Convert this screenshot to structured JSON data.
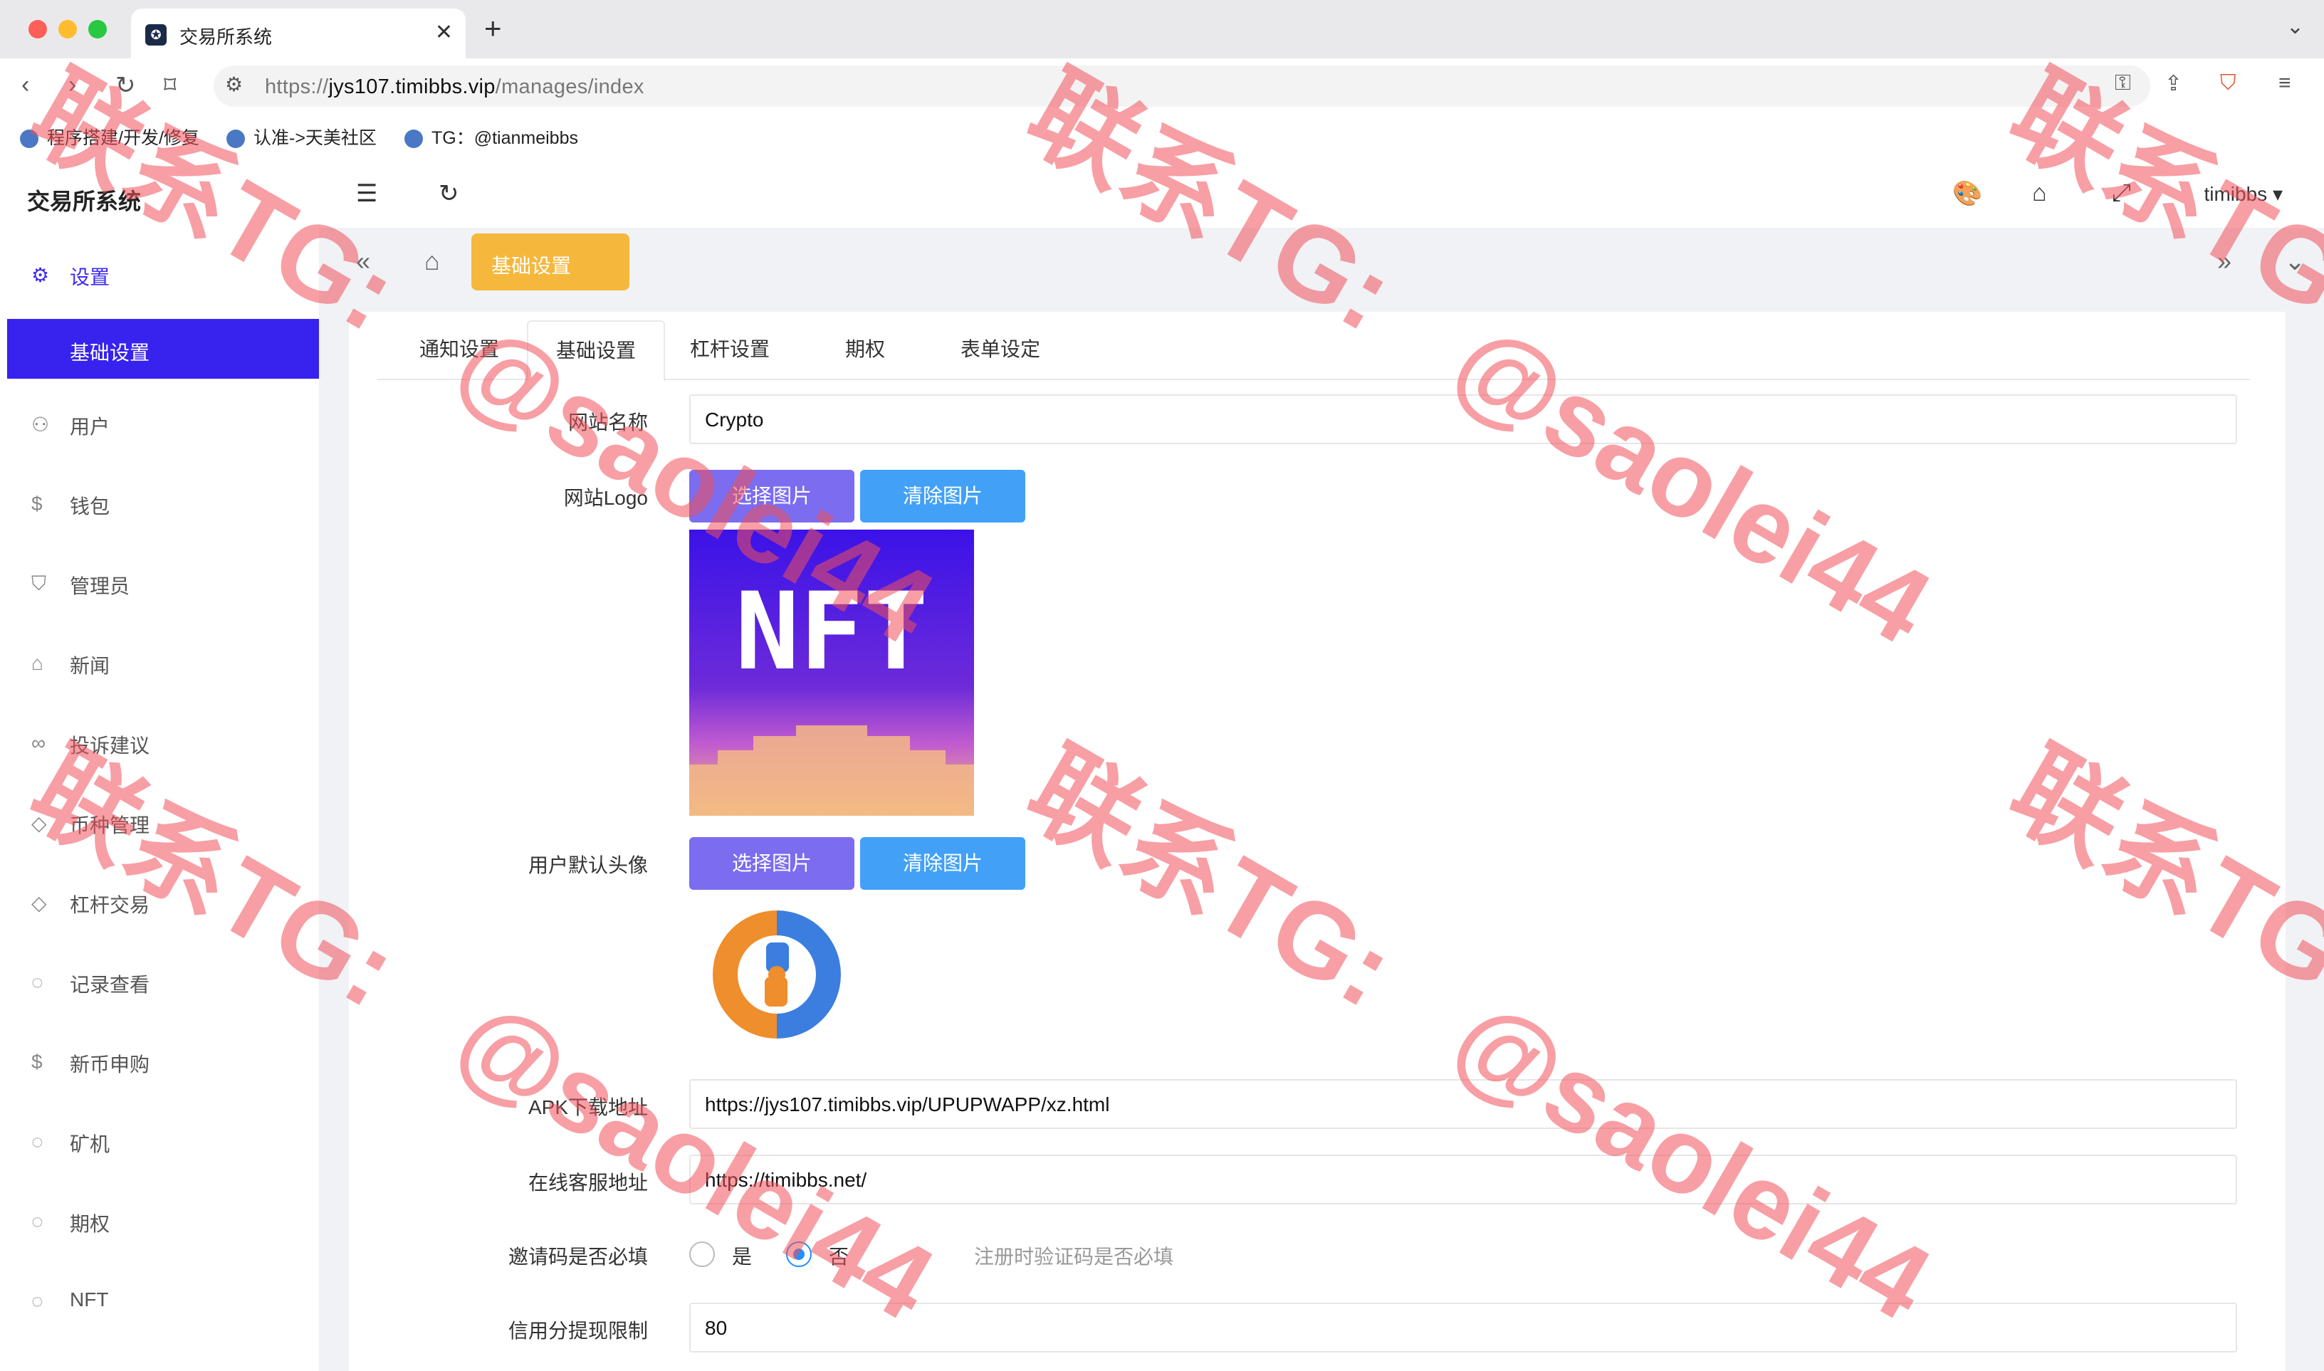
{
  "browser": {
    "tab_title": "交易所系统",
    "url_prefix": "https://",
    "url_host": "jys107.timibbs.vip",
    "url_path": "/manages/index",
    "bookmarks": [
      "程序搭建/开发/修复",
      "认准->天美社区",
      "TG：@tianmeibbs"
    ]
  },
  "sidebar": {
    "title": "交易所系统",
    "items": [
      {
        "label": "设置",
        "icon": "gear-icon"
      },
      {
        "label": "基础设置",
        "icon": ""
      },
      {
        "label": "用户",
        "icon": "user-icon"
      },
      {
        "label": "钱包",
        "icon": "dollar-icon"
      },
      {
        "label": "管理员",
        "icon": "shield-icon"
      },
      {
        "label": "新闻",
        "icon": "tag-icon"
      },
      {
        "label": "投诉建议",
        "icon": "link-icon"
      },
      {
        "label": "币种管理",
        "icon": "diamond-icon"
      },
      {
        "label": "杠杆交易",
        "icon": "diamond-icon"
      },
      {
        "label": "记录查看",
        "icon": "loading-icon"
      },
      {
        "label": "新币申购",
        "icon": "dollar-icon"
      },
      {
        "label": "矿机",
        "icon": "loading-icon"
      },
      {
        "label": "期权",
        "icon": "loading-icon"
      },
      {
        "label": "NFT",
        "icon": "loading-icon"
      }
    ]
  },
  "header": {
    "username": "timibbs"
  },
  "tagbar": {
    "active_tag": "基础设置"
  },
  "tabs": [
    "通知设置",
    "基础设置",
    "杠杆设置",
    "期权",
    "表单设定"
  ],
  "form": {
    "site_name_label": "网站名称",
    "site_name_value": "Crypto",
    "site_logo_label": "网站Logo",
    "select_image": "选择图片",
    "clear_image": "清除图片",
    "logo_text": "NFT",
    "avatar_label": "用户默认头像",
    "apk_label": "APK下载地址",
    "apk_value": "https://jys107.timibbs.vip/UPUPWAPP/xz.html",
    "service_label": "在线客服地址",
    "service_value": "https://timibbs.net/",
    "invite_label": "邀请码是否必填",
    "invite_yes": "是",
    "invite_no": "否",
    "invite_hint": "注册时验证码是否必填",
    "credit_label": "信用分提现限制",
    "credit_value": "80"
  },
  "watermark": [
    "联系TG:",
    "@saolei44"
  ],
  "colors": {
    "accent": "#3722ee",
    "tag": "#f5b83d",
    "btn_select": "#7b6cf0",
    "btn_clear": "#42a1f7"
  }
}
